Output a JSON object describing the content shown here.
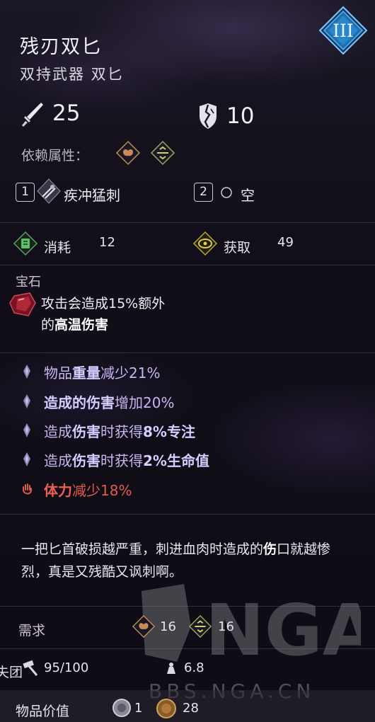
{
  "item": {
    "name": "残刃双匕",
    "type": "双持武器 双匕",
    "tier_badge": "III"
  },
  "stats": {
    "damage": "25",
    "stagger": "10"
  },
  "relations": {
    "label": "依赖属性："
  },
  "skills": [
    {
      "slot": "1",
      "name": "疾冲猛刺"
    },
    {
      "slot": "2",
      "name": "空"
    }
  ],
  "focus": {
    "consume_label": "消耗",
    "consume_value": "12",
    "gain_label": "获取",
    "gain_value": "49"
  },
  "gem": {
    "section_title": "宝石",
    "line1": "攻击会造成15%额外",
    "line2_prefix": "的",
    "line2_bold": "高温伤害"
  },
  "modifiers": [
    {
      "pre": "物品",
      "bold": "重量",
      "post": "减少21%",
      "negative": false
    },
    {
      "pre": "",
      "bold": "造成的伤害",
      "post": "增加20%",
      "negative": false
    },
    {
      "pre": "造成",
      "bold": "伤害",
      "post": "时获得",
      "bold2": "8%专注",
      "negative": false
    },
    {
      "pre": "造成",
      "bold": "伤害",
      "post": "时获得",
      "bold2": "2%生命值",
      "negative": false
    },
    {
      "pre": "",
      "bold": "体力",
      "post": "减少18%",
      "negative": true
    }
  ],
  "description": {
    "part1": "一把匕首破损越严重，刺进血肉时造成的",
    "bold": "伤",
    "part2": "口就越惨烈，真是又残酷又讽刺啊。"
  },
  "requirements": {
    "label": "需求",
    "str_value": "16",
    "dex_value": "16"
  },
  "durability": {
    "label_fragment": "失团",
    "value": "95/100",
    "weight": "6.8"
  },
  "value": {
    "label": "物品价值",
    "coin1": "1",
    "coin2": "28"
  },
  "watermark": {
    "logo_text": "NGA",
    "site": "BBS.NGA.CN"
  },
  "colors": {
    "mod_positive": "#c5b8f0",
    "mod_negative": "#e05a4e",
    "badge_blue": "#2a7fc0",
    "gold": "#c9a55a"
  }
}
